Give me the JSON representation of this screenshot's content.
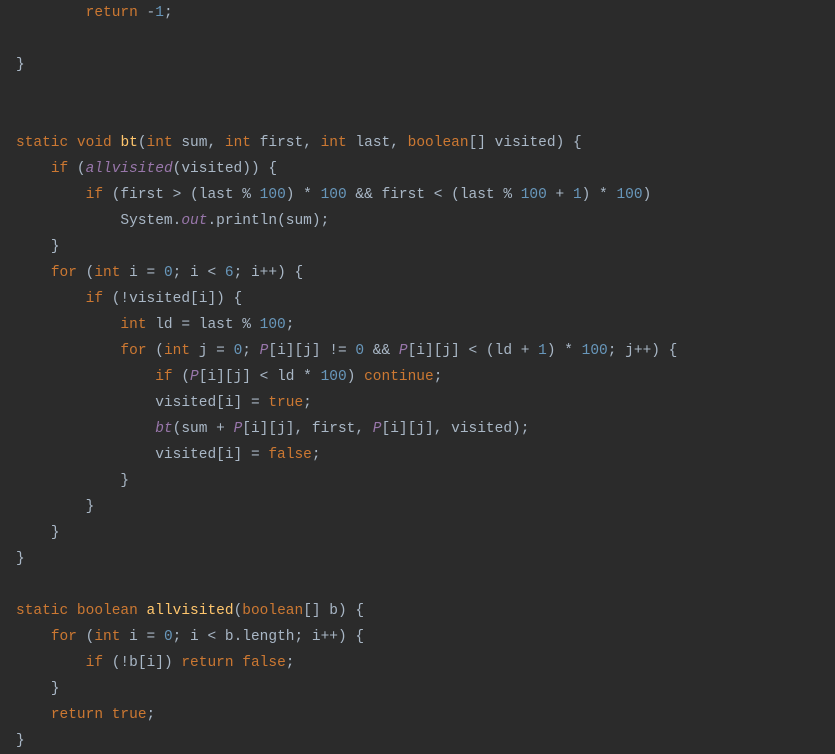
{
  "code": {
    "lines": [
      {
        "indent": 2,
        "tokens": [
          {
            "t": "kw",
            "v": "return"
          },
          {
            "t": "sp"
          },
          {
            "t": "pun",
            "v": "-"
          },
          {
            "t": "num",
            "v": "1"
          },
          {
            "t": "pun",
            "v": ";"
          }
        ]
      },
      {
        "indent": 0,
        "tokens": []
      },
      {
        "indent": 0,
        "tokens": [
          {
            "t": "pun",
            "v": "}"
          }
        ]
      },
      {
        "indent": 0,
        "tokens": []
      },
      {
        "indent": 0,
        "tokens": []
      },
      {
        "indent": 0,
        "tokens": [
          {
            "t": "kw",
            "v": "static"
          },
          {
            "t": "sp"
          },
          {
            "t": "kw",
            "v": "void"
          },
          {
            "t": "sp"
          },
          {
            "t": "fn",
            "v": "bt"
          },
          {
            "t": "pun",
            "v": "("
          },
          {
            "t": "kw",
            "v": "int"
          },
          {
            "t": "sp"
          },
          {
            "t": "ident",
            "v": "sum"
          },
          {
            "t": "pun",
            "v": ","
          },
          {
            "t": "sp"
          },
          {
            "t": "kw",
            "v": "int"
          },
          {
            "t": "sp"
          },
          {
            "t": "ident",
            "v": "first"
          },
          {
            "t": "pun",
            "v": ","
          },
          {
            "t": "sp"
          },
          {
            "t": "kw",
            "v": "int"
          },
          {
            "t": "sp"
          },
          {
            "t": "ident",
            "v": "last"
          },
          {
            "t": "pun",
            "v": ","
          },
          {
            "t": "sp"
          },
          {
            "t": "kw",
            "v": "boolean"
          },
          {
            "t": "pun",
            "v": "[]"
          },
          {
            "t": "sp"
          },
          {
            "t": "ident",
            "v": "visited"
          },
          {
            "t": "pun",
            "v": ")"
          },
          {
            "t": "sp"
          },
          {
            "t": "pun",
            "v": "{"
          }
        ]
      },
      {
        "indent": 1,
        "tokens": [
          {
            "t": "kw",
            "v": "if"
          },
          {
            "t": "sp"
          },
          {
            "t": "pun",
            "v": "("
          },
          {
            "t": "fld",
            "v": "allvisited"
          },
          {
            "t": "pun",
            "v": "(visited))"
          },
          {
            "t": "sp"
          },
          {
            "t": "pun",
            "v": "{"
          }
        ]
      },
      {
        "indent": 2,
        "tokens": [
          {
            "t": "kw",
            "v": "if"
          },
          {
            "t": "sp"
          },
          {
            "t": "pun",
            "v": "(first > (last % "
          },
          {
            "t": "num",
            "v": "100"
          },
          {
            "t": "pun",
            "v": ") * "
          },
          {
            "t": "num",
            "v": "100"
          },
          {
            "t": "sp"
          },
          {
            "t": "pun",
            "v": "&& first < (last % "
          },
          {
            "t": "num",
            "v": "100"
          },
          {
            "t": "sp"
          },
          {
            "t": "pun",
            "v": "+ "
          },
          {
            "t": "num",
            "v": "1"
          },
          {
            "t": "pun",
            "v": ") * "
          },
          {
            "t": "num",
            "v": "100"
          },
          {
            "t": "pun",
            "v": ")"
          }
        ]
      },
      {
        "indent": 3,
        "tokens": [
          {
            "t": "ident",
            "v": "System."
          },
          {
            "t": "fld",
            "v": "out"
          },
          {
            "t": "ident",
            "v": ".println(sum);"
          }
        ]
      },
      {
        "indent": 1,
        "tokens": [
          {
            "t": "pun",
            "v": "}"
          }
        ]
      },
      {
        "indent": 1,
        "tokens": [
          {
            "t": "kw",
            "v": "for"
          },
          {
            "t": "sp"
          },
          {
            "t": "pun",
            "v": "("
          },
          {
            "t": "kw",
            "v": "int"
          },
          {
            "t": "sp"
          },
          {
            "t": "ident",
            "v": "i = "
          },
          {
            "t": "num",
            "v": "0"
          },
          {
            "t": "pun",
            "v": "; i < "
          },
          {
            "t": "num",
            "v": "6"
          },
          {
            "t": "pun",
            "v": "; i++) {"
          }
        ]
      },
      {
        "indent": 2,
        "tokens": [
          {
            "t": "kw",
            "v": "if"
          },
          {
            "t": "sp"
          },
          {
            "t": "pun",
            "v": "(!visited[i]) {"
          }
        ]
      },
      {
        "indent": 3,
        "tokens": [
          {
            "t": "kw",
            "v": "int"
          },
          {
            "t": "sp"
          },
          {
            "t": "ident",
            "v": "ld = last % "
          },
          {
            "t": "num",
            "v": "100"
          },
          {
            "t": "pun",
            "v": ";"
          }
        ]
      },
      {
        "indent": 3,
        "tokens": [
          {
            "t": "kw",
            "v": "for"
          },
          {
            "t": "sp"
          },
          {
            "t": "pun",
            "v": "("
          },
          {
            "t": "kw",
            "v": "int"
          },
          {
            "t": "sp"
          },
          {
            "t": "ident",
            "v": "j = "
          },
          {
            "t": "num",
            "v": "0"
          },
          {
            "t": "pun",
            "v": "; "
          },
          {
            "t": "fld",
            "v": "P"
          },
          {
            "t": "pun",
            "v": "[i][j] != "
          },
          {
            "t": "num",
            "v": "0"
          },
          {
            "t": "sp"
          },
          {
            "t": "pun",
            "v": "&& "
          },
          {
            "t": "fld",
            "v": "P"
          },
          {
            "t": "pun",
            "v": "[i][j] < (ld + "
          },
          {
            "t": "num",
            "v": "1"
          },
          {
            "t": "pun",
            "v": ") * "
          },
          {
            "t": "num",
            "v": "100"
          },
          {
            "t": "pun",
            "v": "; j++) {"
          }
        ]
      },
      {
        "indent": 4,
        "tokens": [
          {
            "t": "kw",
            "v": "if"
          },
          {
            "t": "sp"
          },
          {
            "t": "pun",
            "v": "("
          },
          {
            "t": "fld",
            "v": "P"
          },
          {
            "t": "pun",
            "v": "[i][j] < ld * "
          },
          {
            "t": "num",
            "v": "100"
          },
          {
            "t": "pun",
            "v": ")"
          },
          {
            "t": "sp"
          },
          {
            "t": "kw",
            "v": "continue"
          },
          {
            "t": "pun",
            "v": ";"
          }
        ]
      },
      {
        "indent": 4,
        "tokens": [
          {
            "t": "ident",
            "v": "visited[i] = "
          },
          {
            "t": "kw",
            "v": "true"
          },
          {
            "t": "pun",
            "v": ";"
          }
        ]
      },
      {
        "indent": 4,
        "tokens": [
          {
            "t": "fld",
            "v": "bt"
          },
          {
            "t": "pun",
            "v": "(sum + "
          },
          {
            "t": "fld",
            "v": "P"
          },
          {
            "t": "pun",
            "v": "[i][j], first, "
          },
          {
            "t": "fld",
            "v": "P"
          },
          {
            "t": "pun",
            "v": "[i][j], visited);"
          }
        ]
      },
      {
        "indent": 4,
        "tokens": [
          {
            "t": "ident",
            "v": "visited[i] = "
          },
          {
            "t": "kw",
            "v": "false"
          },
          {
            "t": "pun",
            "v": ";"
          }
        ]
      },
      {
        "indent": 3,
        "tokens": [
          {
            "t": "pun",
            "v": "}"
          }
        ]
      },
      {
        "indent": 2,
        "tokens": [
          {
            "t": "pun",
            "v": "}"
          }
        ]
      },
      {
        "indent": 1,
        "tokens": [
          {
            "t": "pun",
            "v": "}"
          }
        ]
      },
      {
        "indent": 0,
        "tokens": [
          {
            "t": "pun",
            "v": "}"
          }
        ]
      },
      {
        "indent": 0,
        "tokens": []
      },
      {
        "indent": 0,
        "tokens": [
          {
            "t": "kw",
            "v": "static"
          },
          {
            "t": "sp"
          },
          {
            "t": "kw",
            "v": "boolean"
          },
          {
            "t": "sp"
          },
          {
            "t": "fn",
            "v": "allvisited"
          },
          {
            "t": "pun",
            "v": "("
          },
          {
            "t": "kw",
            "v": "boolean"
          },
          {
            "t": "pun",
            "v": "[] b) {"
          }
        ]
      },
      {
        "indent": 1,
        "tokens": [
          {
            "t": "kw",
            "v": "for"
          },
          {
            "t": "sp"
          },
          {
            "t": "pun",
            "v": "("
          },
          {
            "t": "kw",
            "v": "int"
          },
          {
            "t": "sp"
          },
          {
            "t": "ident",
            "v": "i = "
          },
          {
            "t": "num",
            "v": "0"
          },
          {
            "t": "pun",
            "v": "; i < b.length; i++) {"
          }
        ]
      },
      {
        "indent": 2,
        "tokens": [
          {
            "t": "kw",
            "v": "if"
          },
          {
            "t": "sp"
          },
          {
            "t": "pun",
            "v": "(!b[i])"
          },
          {
            "t": "sp"
          },
          {
            "t": "kw",
            "v": "return"
          },
          {
            "t": "sp"
          },
          {
            "t": "kw",
            "v": "false"
          },
          {
            "t": "pun",
            "v": ";"
          }
        ]
      },
      {
        "indent": 1,
        "tokens": [
          {
            "t": "pun",
            "v": "}"
          }
        ]
      },
      {
        "indent": 1,
        "tokens": [
          {
            "t": "kw",
            "v": "return"
          },
          {
            "t": "sp"
          },
          {
            "t": "kw",
            "v": "true"
          },
          {
            "t": "pun",
            "v": ";"
          }
        ]
      },
      {
        "indent": 0,
        "tokens": [
          {
            "t": "pun",
            "v": "}"
          }
        ]
      }
    ],
    "indent_unit": "    "
  }
}
